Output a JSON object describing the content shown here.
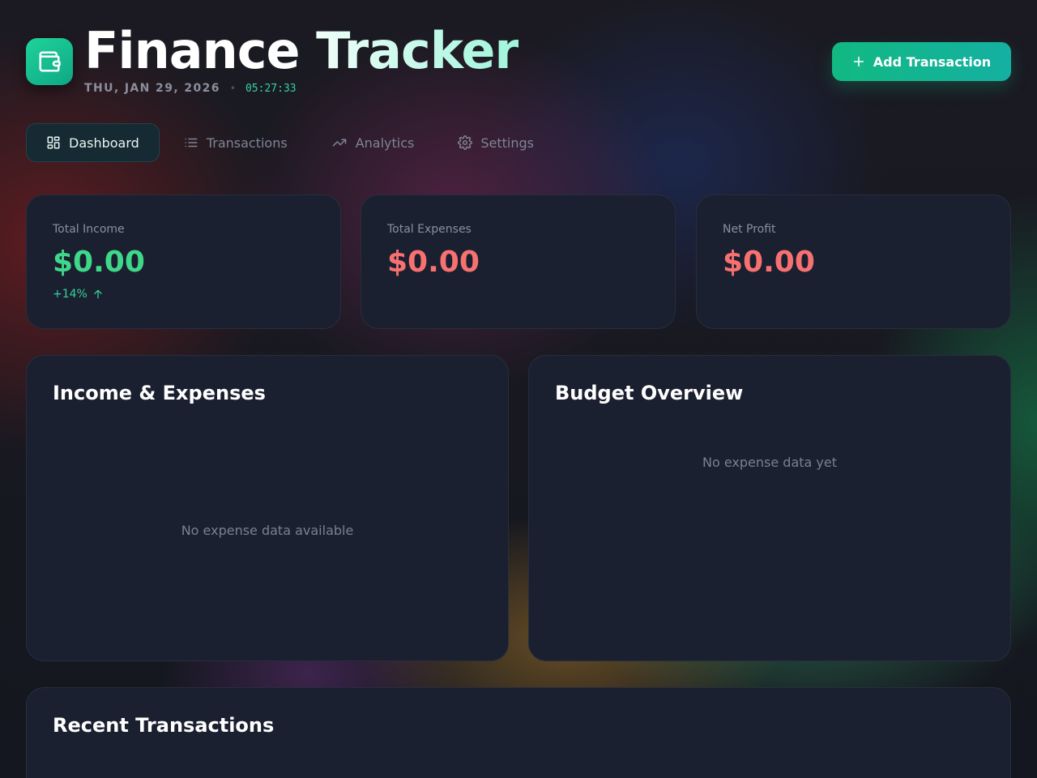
{
  "header": {
    "title": "Finance Tracker",
    "date": "THU, JAN 29, 2026",
    "separator": "•",
    "time": "05:27:33",
    "logo_icon": "wallet-icon",
    "add_button_label": "Add Transaction",
    "add_button_icon": "plus-icon"
  },
  "tabs": [
    {
      "label": "Dashboard",
      "icon": "grid-icon",
      "active": true
    },
    {
      "label": "Transactions",
      "icon": "list-icon",
      "active": false
    },
    {
      "label": "Analytics",
      "icon": "trending-up-icon",
      "active": false
    },
    {
      "label": "Settings",
      "icon": "gear-icon",
      "active": false
    }
  ],
  "stats": {
    "income": {
      "label": "Total Income",
      "value": "$0.00",
      "trend": "+14%",
      "trend_icon": "arrow-up-icon",
      "color": "#3fd88a"
    },
    "expenses": {
      "label": "Total Expenses",
      "value": "$0.00",
      "color": "#f87171"
    },
    "profit": {
      "label": "Net Profit",
      "value": "$0.00",
      "color": "#f87171"
    }
  },
  "panels": {
    "income_expenses": {
      "title": "Income & Expenses",
      "empty_text": "No expense data available"
    },
    "budget": {
      "title": "Budget Overview",
      "empty_text": "No expense data yet"
    },
    "recent": {
      "title": "Recent Transactions"
    }
  },
  "colors": {
    "accent": "#12b981",
    "card_bg": "#1b2030",
    "positive": "#3fd88a",
    "negative": "#f87171"
  }
}
